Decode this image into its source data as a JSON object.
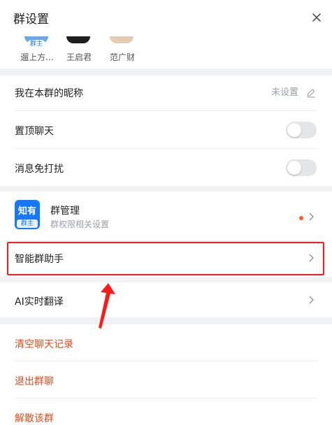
{
  "header": {
    "title": "群设置",
    "close_icon": "close-icon"
  },
  "members": [
    {
      "name": "遛上方...",
      "badge": "群主"
    },
    {
      "name": "王启君"
    },
    {
      "name": "范广财"
    }
  ],
  "settings": {
    "nickname": {
      "label": "我在本群的昵称",
      "value": "未设置"
    },
    "pin_chat": {
      "label": "置顶聊天",
      "enabled": false
    },
    "mute": {
      "label": "消息免打扰",
      "enabled": false
    }
  },
  "group_manage": {
    "icon_text": "知有",
    "icon_badge": "群主",
    "title": "群管理",
    "subtitle": "群权限相关设置"
  },
  "items": {
    "assistant": {
      "label": "智能群助手"
    },
    "ai_translate": {
      "label": "AI实时翻译"
    }
  },
  "actions": {
    "clear_history": "清空聊天记录",
    "leave_group": "退出群聊",
    "dissolve_group": "解散该群"
  },
  "colors": {
    "accent": "#1677ff",
    "danger": "#e64a19",
    "highlight": "#ff1a1a",
    "separator": "#f1f2f4"
  }
}
